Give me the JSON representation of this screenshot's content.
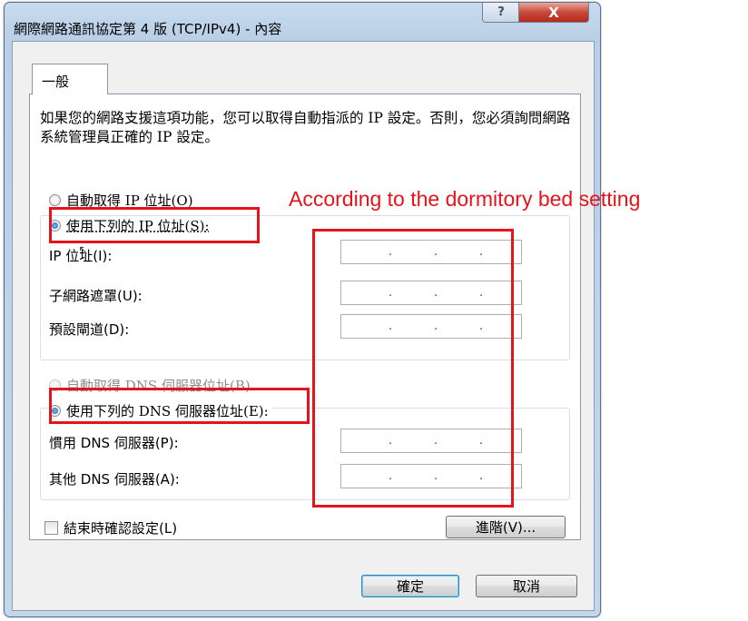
{
  "window": {
    "title": "網際網路通訊協定第 4 版 (TCP/IPv4) - 內容",
    "help_button": "?",
    "close_button": "X"
  },
  "tab": {
    "label": "一般"
  },
  "description": "如果您的網路支援這項功能，您可以取得自動指派的 IP 設定。否則，您必須詢問網路系統管理員正確的 IP 設定。",
  "ip_section": {
    "auto_radio": {
      "label": "自動取得 IP 位址(O)",
      "selected": false
    },
    "manual_radio": {
      "label": "使用下列的 IP 位址(S):",
      "selected": true
    },
    "fields": [
      {
        "label": "IP 位址(I):",
        "value": ". . ."
      },
      {
        "label": "子網路遮罩(U):",
        "value": ". . ."
      },
      {
        "label": "預設閘道(D):",
        "value": ". . ."
      }
    ]
  },
  "dns_section": {
    "auto_radio": {
      "label": "自動取得 DNS 伺服器位址(B)",
      "selected": false,
      "enabled": false
    },
    "manual_radio": {
      "label": "使用下列的 DNS 伺服器位址(E):",
      "selected": true
    },
    "fields": [
      {
        "label": "慣用 DNS 伺服器(P):",
        "value": ". . ."
      },
      {
        "label": "其他 DNS 伺服器(A):",
        "value": ". . ."
      }
    ]
  },
  "validate_checkbox": {
    "label": "結束時確認設定(L)",
    "checked": false
  },
  "buttons": {
    "advanced": "進階(V)...",
    "ok": "確定",
    "cancel": "取消"
  },
  "annotation": {
    "text": "According to the dormitory bed setting",
    "color": "#e5141b"
  }
}
